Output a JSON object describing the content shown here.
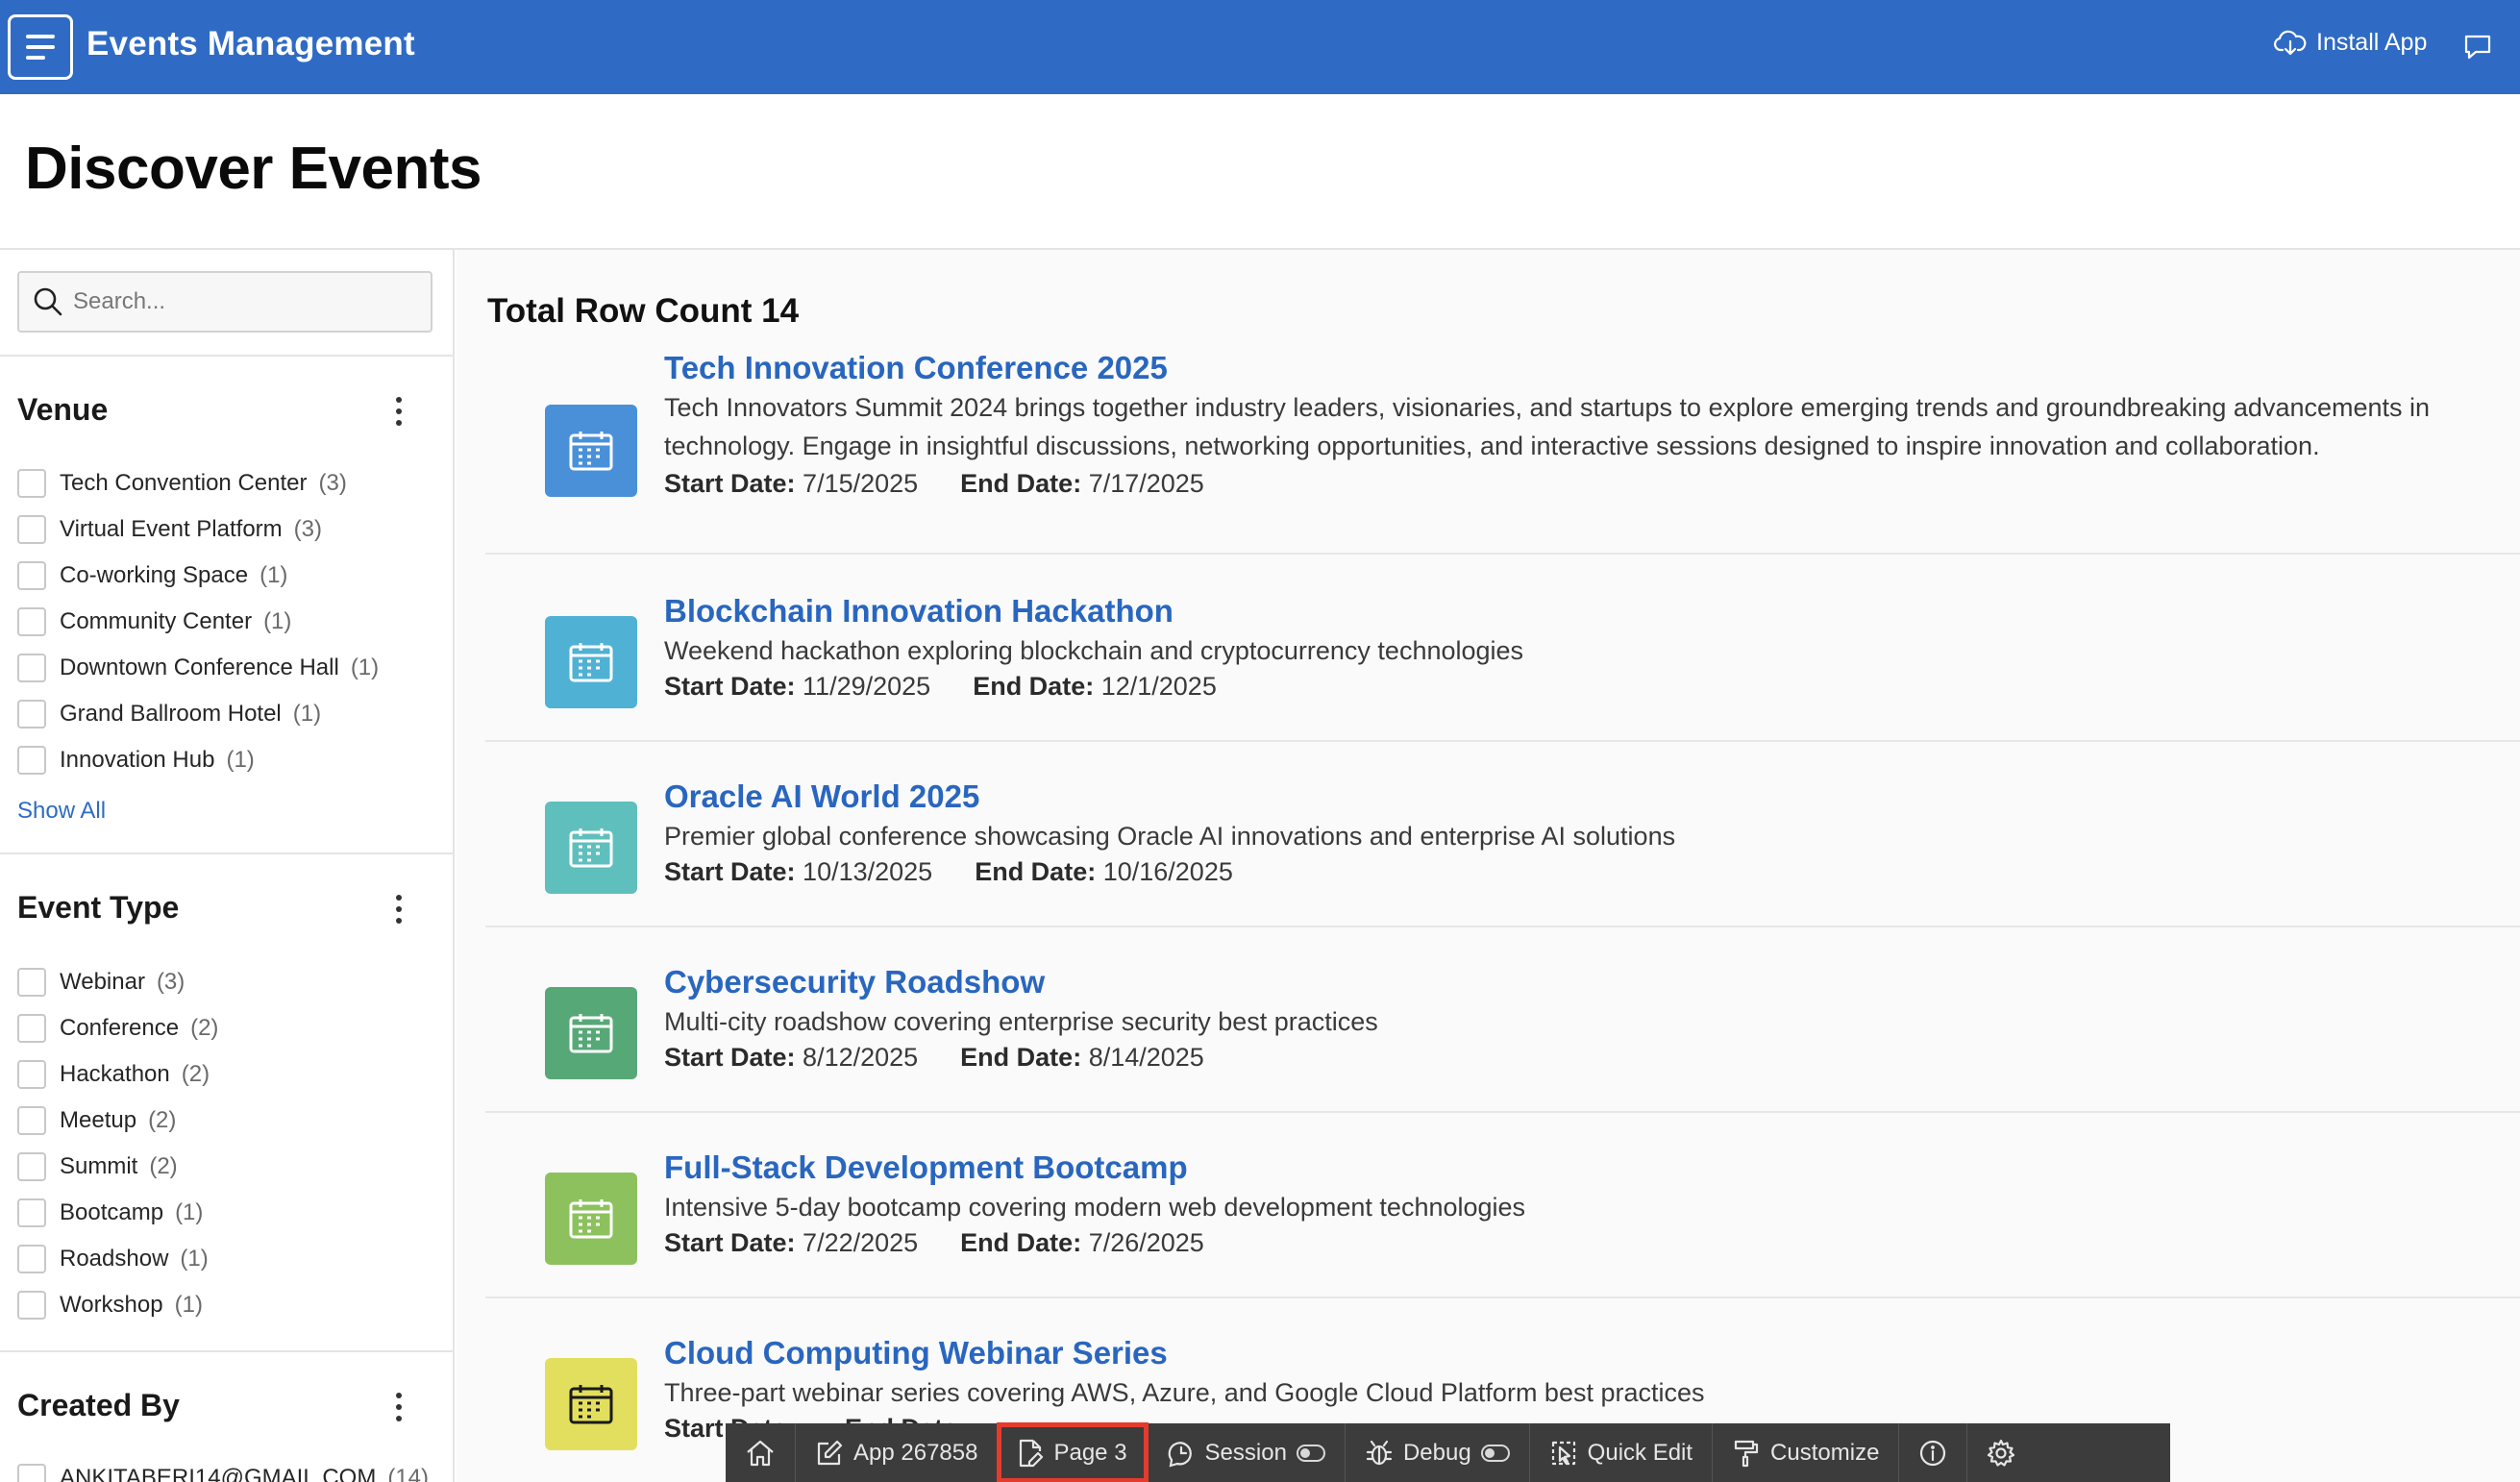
{
  "header": {
    "app_title": "Events Management",
    "install_label": "Install App",
    "menu_icon": "hamburger-menu-icon",
    "install_icon": "cloud-download-icon",
    "feedback_icon": "chat-bubble-icon",
    "bar_color": "#2f6bc4"
  },
  "page": {
    "title": "Discover Events"
  },
  "sidebar": {
    "search_placeholder": "Search...",
    "facets": [
      {
        "title": "Venue",
        "items": [
          {
            "label": "Tech Convention Center",
            "count": "(3)"
          },
          {
            "label": "Virtual Event Platform",
            "count": "(3)"
          },
          {
            "label": "Co-working Space",
            "count": "(1)"
          },
          {
            "label": "Community Center",
            "count": "(1)"
          },
          {
            "label": "Downtown Conference Hall",
            "count": "(1)"
          },
          {
            "label": "Grand Ballroom Hotel",
            "count": "(1)"
          },
          {
            "label": "Innovation Hub",
            "count": "(1)"
          }
        ],
        "show_all": "Show All"
      },
      {
        "title": "Event Type",
        "items": [
          {
            "label": "Webinar",
            "count": "(3)"
          },
          {
            "label": "Conference",
            "count": "(2)"
          },
          {
            "label": "Hackathon",
            "count": "(2)"
          },
          {
            "label": "Meetup",
            "count": "(2)"
          },
          {
            "label": "Summit",
            "count": "(2)"
          },
          {
            "label": "Bootcamp",
            "count": "(1)"
          },
          {
            "label": "Roadshow",
            "count": "(1)"
          },
          {
            "label": "Workshop",
            "count": "(1)"
          }
        ]
      },
      {
        "title": "Created By",
        "items": [
          {
            "label": "ANKITABERI14@GMAIL.COM",
            "count": "(14)"
          }
        ]
      }
    ]
  },
  "main": {
    "row_count_label": "Total Row Count 14",
    "start_label": "Start Date:",
    "end_label": "End Date:",
    "events": [
      {
        "title": "Tech Innovation Conference 2025",
        "description": "Tech Innovators Summit 2024 brings together industry leaders, visionaries, and startups to explore emerging trends and groundbreaking advancements in technology. Engage in insightful discussions, networking opportunities, and interactive sessions designed to inspire innovation and collaboration.",
        "start": "7/15/2025",
        "end": "7/17/2025",
        "icon_color": "#4a90d9"
      },
      {
        "title": "Blockchain Innovation Hackathon",
        "description": "Weekend hackathon exploring blockchain and cryptocurrency technologies",
        "start": "11/29/2025",
        "end": "12/1/2025",
        "icon_color": "#4fb1d4"
      },
      {
        "title": "Oracle AI World 2025",
        "description": "Premier global conference showcasing Oracle AI innovations and enterprise AI solutions",
        "start": "10/13/2025",
        "end": "10/16/2025",
        "icon_color": "#5fbfbd"
      },
      {
        "title": "Cybersecurity Roadshow",
        "description": "Multi-city roadshow covering enterprise security best practices",
        "start": "8/12/2025",
        "end": "8/14/2025",
        "icon_color": "#56a877"
      },
      {
        "title": "Full-Stack Development Bootcamp",
        "description": "Intensive 5-day bootcamp covering modern web development technologies",
        "start": "7/22/2025",
        "end": "7/26/2025",
        "icon_color": "#8cc15e"
      },
      {
        "title": "Cloud Computing Webinar Series",
        "description": "Three-part webinar series covering AWS, Azure, and Google Cloud Platform best practices",
        "start": "",
        "end": "",
        "icon_color": "#e3df5e"
      }
    ]
  },
  "devbar": {
    "items": [
      {
        "label": "",
        "icon": "home-icon"
      },
      {
        "label": "App 267858",
        "icon": "edit-icon"
      },
      {
        "label": "Page 3",
        "icon": "page-edit-icon"
      },
      {
        "label": "Session",
        "icon": "session-icon"
      },
      {
        "label": "Debug",
        "icon": "bug-icon"
      },
      {
        "label": "Quick Edit",
        "icon": "quick-edit-icon"
      },
      {
        "label": "Customize",
        "icon": "paint-roller-icon"
      },
      {
        "label": "",
        "icon": "info-icon"
      },
      {
        "label": "",
        "icon": "gear-icon"
      }
    ],
    "highlight_color": "#e53b2c"
  }
}
